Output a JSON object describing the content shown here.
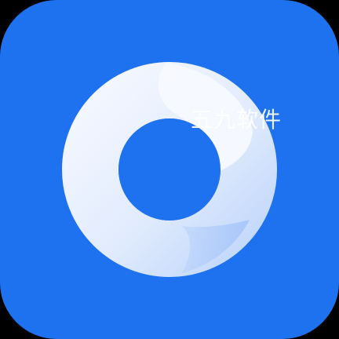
{
  "app_icon": {
    "background_color": "#1f72ef",
    "ring_light_color": "#f2f6ff",
    "ring_shade_color": "#a9c8fb"
  },
  "watermark": {
    "text": "五九软件"
  }
}
